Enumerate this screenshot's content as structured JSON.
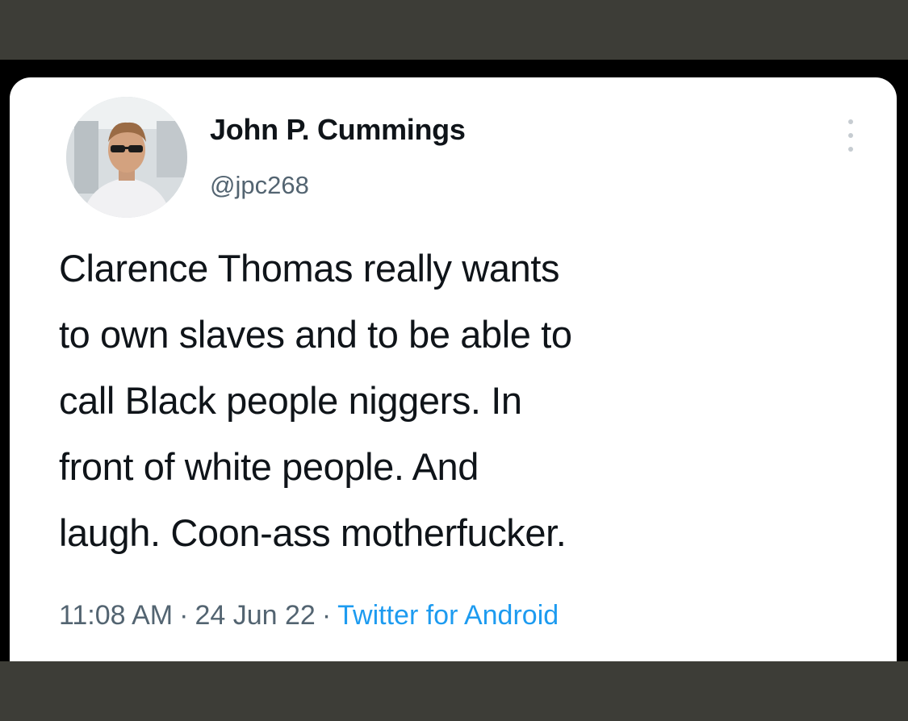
{
  "tweet": {
    "display_name": "John P. Cummings",
    "handle": "@jpc268",
    "text": "Clarence Thomas really wants\nto own slaves and to be able to\ncall Black people niggers. In\nfront of white people. And\nlaugh. Coon-ass motherfucker.",
    "time": "11:08 AM",
    "separator": "·",
    "date": "24 Jun 22",
    "source": "Twitter for Android",
    "more_icon": "more-vertical-icon"
  },
  "colors": {
    "background_frame": "#3d3d37",
    "card": "#ffffff",
    "text_primary": "#0f1419",
    "text_secondary": "#536471",
    "link": "#1d9bf0"
  }
}
